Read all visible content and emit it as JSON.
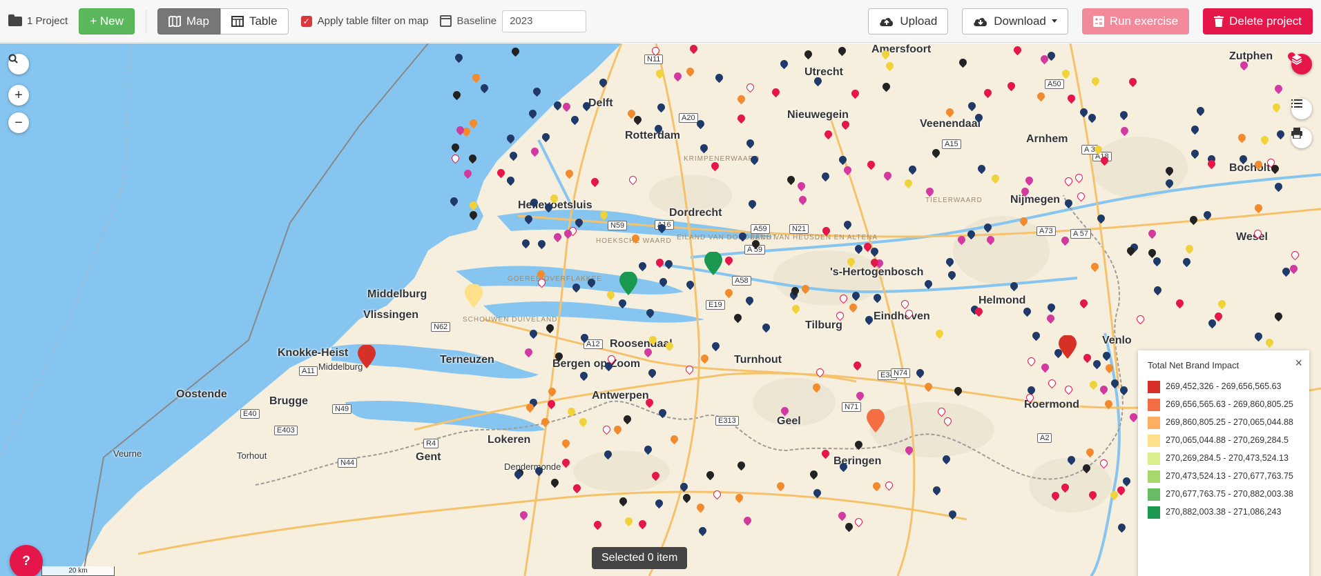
{
  "toolbar": {
    "project_label": "1 Project",
    "new_label": "+ New",
    "map_label": "Map",
    "table_label": "Table",
    "apply_filter_label": "Apply table filter on map",
    "apply_filter_checked": true,
    "baseline_label": "Baseline",
    "baseline_value": "2023",
    "upload_label": "Upload",
    "download_label": "Download",
    "run_label": "Run exercise",
    "delete_label": "Delete project"
  },
  "map": {
    "cities": [
      "Amersfoort",
      "Utrecht",
      "Nieuwegein",
      "Veenendaal",
      "Arnhem",
      "Nijmegen",
      "Dordrecht",
      "Hellevoetsluis",
      "'s-Hertogenbosch",
      "Tilburg",
      "Roosendaal",
      "Bergen op Zoom",
      "Middelburg",
      "Vlissingen",
      "Terneuzen",
      "Eindhoven",
      "Helmond",
      "Venlo",
      "Roermond",
      "Turnhout",
      "Antwerpen",
      "Brugge",
      "Oostende",
      "Knokke-Heist",
      "Gent",
      "Lokeren",
      "Geel",
      "Beringen",
      "Bocholt",
      "Wesel",
      "Zutphen",
      "Middelburg",
      "Torhout",
      "Veurne",
      "Dendermonde",
      "Delft",
      "Rotterdam"
    ],
    "regions": [
      "GOEREE OVERFLAKKEE",
      "SCHOUWEN DUIVELAND",
      "HOEKSCHE WAARD",
      "EILAND VAN DORDRECHT",
      "LAND VAN HEUSDEN EN ALTENA",
      "TIELERWAARD",
      "KRIMPENERWAARD"
    ],
    "road_labels": [
      "A50",
      "A15",
      "A16",
      "A59",
      "N59",
      "A58",
      "E19",
      "E34",
      "N62",
      "A12",
      "A73",
      "A 57",
      "E313",
      "N71",
      "N74",
      "A2",
      "E40",
      "E403",
      "N44",
      "R4",
      "N49",
      "A11",
      "A18",
      "A 3",
      "N11",
      "A20",
      "A 59",
      "N21"
    ],
    "scale_label": "20 km",
    "selected_text": "Selected 0 item"
  },
  "controls": {
    "search_icon": "search-icon",
    "zoom_in": "+",
    "zoom_out": "−",
    "help": "?",
    "legend_close": "×"
  },
  "legend": {
    "title": "Total Net Brand Impact",
    "items": [
      {
        "label": "269,452,326 - 269,656,565.63",
        "color": "#d73027"
      },
      {
        "label": "269,656,565.63 - 269,860,805.25",
        "color": "#f46d43"
      },
      {
        "label": "269,860,805.25 - 270,065,044.88",
        "color": "#fdae61"
      },
      {
        "label": "270,065,044.88 - 270,269,284.5",
        "color": "#fee08b"
      },
      {
        "label": "270,269,284.5 - 270,473,524.13",
        "color": "#d9ef8b"
      },
      {
        "label": "270,473,524.13 - 270,677,763.75",
        "color": "#a6d96a"
      },
      {
        "label": "270,677,763.75 - 270,882,003.38",
        "color": "#66bd63"
      },
      {
        "label": "270,882,003.38 - 271,086,243",
        "color": "#1a9850"
      }
    ]
  },
  "colors": {
    "accent": "#e5174a",
    "green": "#5cb85c",
    "water": "#86c5f0",
    "land": "#f6efde"
  }
}
